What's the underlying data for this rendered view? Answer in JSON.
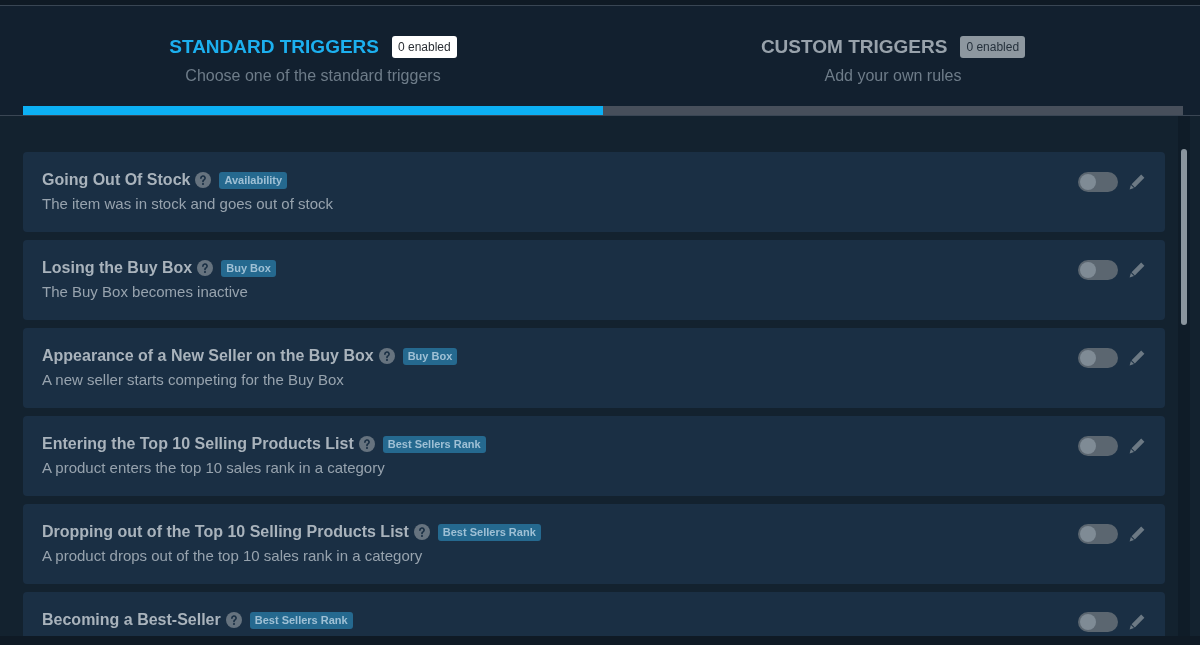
{
  "tabs": [
    {
      "title": "STANDARD TRIGGERS",
      "badge": "0 enabled",
      "subtitle": "Choose one of the standard triggers",
      "selected": true
    },
    {
      "title": "CUSTOM TRIGGERS",
      "badge": "0 enabled",
      "subtitle": "Add your own rules",
      "selected": false
    }
  ],
  "triggers": [
    {
      "title": "Going Out Of Stock",
      "category": "Availability",
      "description": "The item was in stock and goes out of stock",
      "enabled": false
    },
    {
      "title": "Losing the Buy Box",
      "category": "Buy Box",
      "description": "The Buy Box becomes inactive",
      "enabled": false
    },
    {
      "title": "Appearance of a New Seller on the Buy Box",
      "category": "Buy Box",
      "description": "A new seller starts competing for the Buy Box",
      "enabled": false
    },
    {
      "title": "Entering the Top 10 Selling Products List",
      "category": "Best Sellers Rank",
      "description": "A product enters the top 10 sales rank in a category",
      "enabled": false
    },
    {
      "title": "Dropping out of the Top 10 Selling Products List",
      "category": "Best Sellers Rank",
      "description": "A product drops out of the top 10 sales rank in a category",
      "enabled": false
    },
    {
      "title": "Becoming a Best-Seller",
      "category": "Best Sellers Rank",
      "enabled": false
    }
  ]
}
